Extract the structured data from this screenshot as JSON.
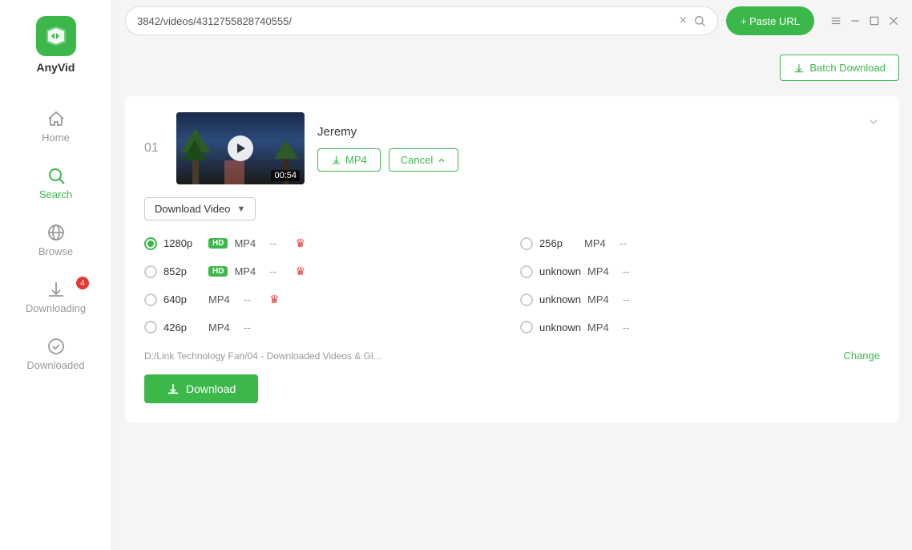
{
  "app": {
    "name": "AnyVid"
  },
  "titlebar": {
    "url": "3842/videos/4312755828740555/",
    "clear_label": "×",
    "paste_url_label": "+ Paste URL",
    "window_controls": [
      "menu",
      "minimize",
      "maximize",
      "close"
    ]
  },
  "batch_download": {
    "label": "Batch Download"
  },
  "sidebar": {
    "items": [
      {
        "id": "home",
        "label": "Home",
        "active": false
      },
      {
        "id": "search",
        "label": "Search",
        "active": true
      },
      {
        "id": "browse",
        "label": "Browse",
        "active": false
      },
      {
        "id": "downloading",
        "label": "Downloading",
        "active": false,
        "badge": "4"
      },
      {
        "id": "downloaded",
        "label": "Downloaded",
        "active": false
      }
    ]
  },
  "video": {
    "number": "01",
    "title": "Jeremy",
    "duration": "00:54",
    "mp4_label": "MP4",
    "cancel_label": "Cancel",
    "download_video_label": "Download Video",
    "quality_options": [
      {
        "id": "1280p",
        "label": "1280p",
        "hd": true,
        "format": "MP4",
        "size": "--",
        "premium": true,
        "selected": true,
        "col": "left"
      },
      {
        "id": "852p",
        "label": "852p",
        "hd": true,
        "format": "MP4",
        "size": "--",
        "premium": true,
        "selected": false,
        "col": "left"
      },
      {
        "id": "640p",
        "label": "640p",
        "hd": false,
        "format": "MP4",
        "size": "--",
        "premium": true,
        "selected": false,
        "col": "left"
      },
      {
        "id": "426p",
        "label": "426p",
        "hd": false,
        "format": "MP4",
        "size": "--",
        "premium": false,
        "selected": false,
        "col": "left"
      },
      {
        "id": "256p",
        "label": "256p",
        "hd": false,
        "format": "MP4",
        "size": "--",
        "premium": false,
        "selected": false,
        "col": "right"
      },
      {
        "id": "unknown1",
        "label": "unknown",
        "hd": false,
        "format": "MP4",
        "size": "--",
        "premium": false,
        "selected": false,
        "col": "right"
      },
      {
        "id": "unknown2",
        "label": "unknown",
        "hd": false,
        "format": "MP4",
        "size": "--",
        "premium": false,
        "selected": false,
        "col": "right"
      },
      {
        "id": "unknown3",
        "label": "unknown",
        "hd": false,
        "format": "MP4",
        "size": "--",
        "premium": false,
        "selected": false,
        "col": "right"
      }
    ],
    "file_path": "D:/Link Technology Fan/04 - Downloaded Videos & Gl...",
    "change_label": "Change",
    "download_label": "Download"
  },
  "colors": {
    "green": "#3cb84a",
    "red": "#e53935",
    "text_dark": "#333",
    "text_light": "#999"
  }
}
